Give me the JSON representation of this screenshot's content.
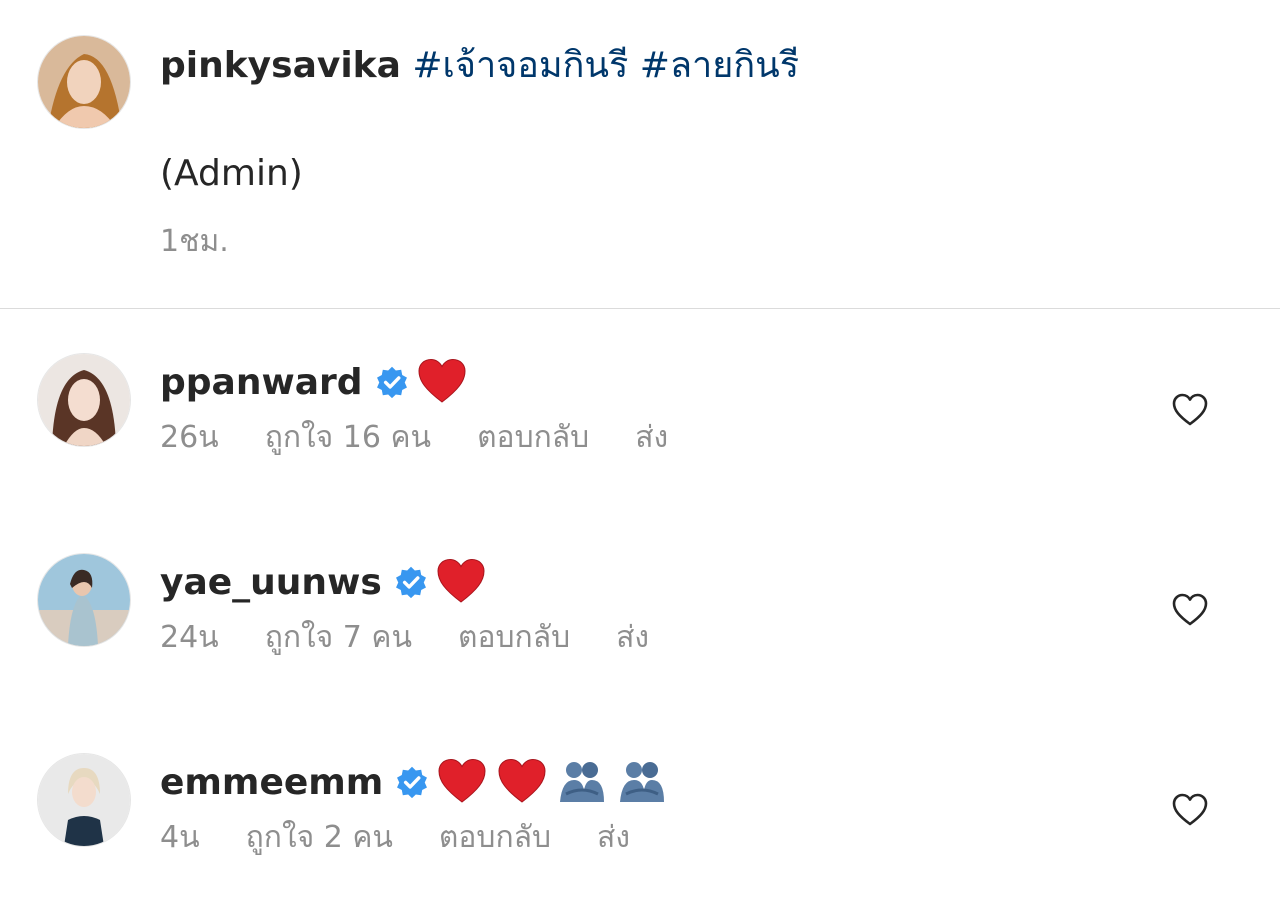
{
  "post": {
    "author": "pinkysavika",
    "hashtags": [
      "#เจ้าจอมกินรี",
      "#ลายกินรี"
    ],
    "body": "(Admin)",
    "time": "1ชม."
  },
  "comments": [
    {
      "username": "ppanward",
      "verified": true,
      "emojis": [
        "red-heart"
      ],
      "time": "26น",
      "likes": "ถูกใจ 16 คน",
      "reply": "ตอบกลับ",
      "send": "ส่ง"
    },
    {
      "username": "yae_uunws",
      "verified": true,
      "emojis": [
        "red-heart"
      ],
      "time": "24น",
      "likes": "ถูกใจ 7 คน",
      "reply": "ตอบกลับ",
      "send": "ส่ง"
    },
    {
      "username": "emmeemm",
      "verified": true,
      "emojis": [
        "red-heart",
        "red-heart",
        "hugging-people",
        "hugging-people"
      ],
      "time": "4น",
      "likes": "ถูกใจ 2 คน",
      "reply": "ตอบกลับ",
      "send": "ส่ง"
    }
  ],
  "colors": {
    "text": "#262626",
    "secondary": "#8e8e8e",
    "hashtag": "#00376b",
    "verified": "#3897f0",
    "heart": "#e0202a",
    "divider": "#dbdbdb"
  }
}
